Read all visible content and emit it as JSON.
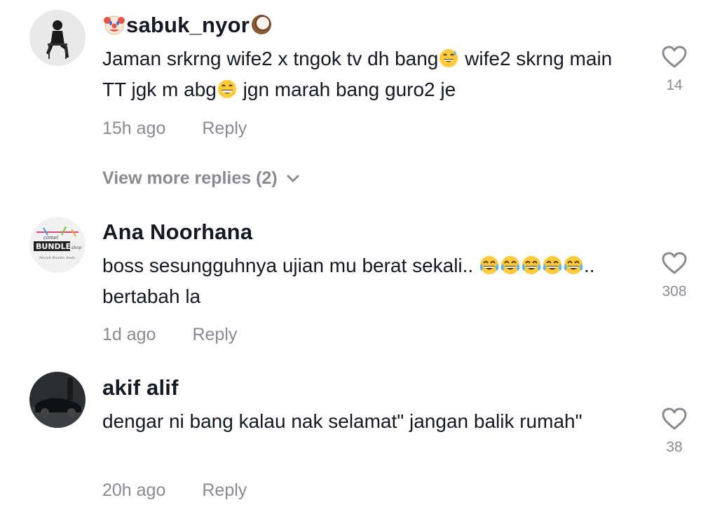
{
  "comments": [
    {
      "username_prefix_emoji": "clown-face-emoji",
      "username": "sabuk_nyor",
      "username_suffix_emoji": "coconut-emoji",
      "text_part1": "Jaman srkrng wife2 x tngok tv dh bang",
      "emoji1": "sweat-smile-emoji",
      "text_part2": " wife2 skrng main TT jgk m abg",
      "emoji2": "grin-emoji",
      "text_part3": " jgn marah bang guro2 je",
      "time": "15h ago",
      "reply_label": "Reply",
      "likes": "14"
    },
    {
      "username": "Ana Noorhana",
      "text_part1": "boss sesungguhnya ujian mu berat sekali.. ",
      "emoji": "joy-emoji",
      "emoji_count": 5,
      "text_part2": ".. bertabah la",
      "time": "1d ago",
      "reply_label": "Reply",
      "likes": "308",
      "avatar_text_top": "comel",
      "avatar_text_main": "BUNDLE",
      "avatar_text_side": "shop",
      "avatar_text_bottom": "Murah Bundle Anda"
    },
    {
      "username": "akif alif",
      "text": "dengar ni bang kalau nak selamat\" jangan balik rumah\"",
      "time": "20h ago",
      "reply_label": "Reply",
      "likes": "38"
    }
  ],
  "view_more_replies": "View more replies (2)",
  "colors": {
    "text": "#161823",
    "muted": "#8a8b91",
    "heart_outline": "#8a8b91"
  }
}
